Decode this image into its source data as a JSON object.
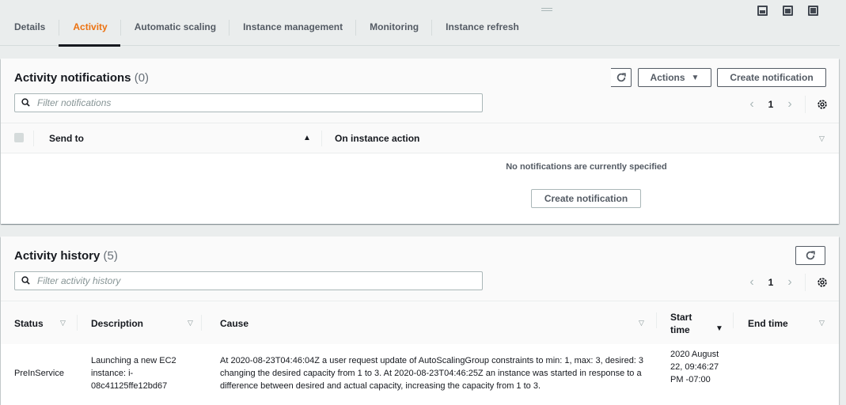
{
  "tabs": [
    {
      "label": "Details",
      "active": false
    },
    {
      "label": "Activity",
      "active": true
    },
    {
      "label": "Automatic scaling",
      "active": false
    },
    {
      "label": "Instance management",
      "active": false
    },
    {
      "label": "Monitoring",
      "active": false
    },
    {
      "label": "Instance refresh",
      "active": false
    }
  ],
  "view_icons": [
    "split-bottom-small-icon",
    "split-bottom-large-icon",
    "full-view-icon"
  ],
  "colors": {
    "accent": "#ec7211",
    "text": "#16191f",
    "muted": "#545b64",
    "background": "#eaeded"
  },
  "notifications": {
    "title": "Activity notifications",
    "count": "(0)",
    "refresh_icon": "refresh-icon",
    "actions_label": "Actions",
    "create_label": "Create notification",
    "filter_placeholder": "Filter notifications",
    "pagination": {
      "page": "1"
    },
    "columns": [
      {
        "label": "Send to",
        "sort": "ascending"
      },
      {
        "label": "On instance action",
        "sort": "none"
      }
    ],
    "empty_message": "No notifications are currently specified",
    "empty_create_label": "Create notification"
  },
  "history": {
    "title": "Activity history",
    "count": "(5)",
    "refresh_icon": "refresh-icon",
    "filter_placeholder": "Filter activity history",
    "pagination": {
      "page": "1"
    },
    "columns": [
      {
        "label": "Status",
        "sort": "none"
      },
      {
        "label": "Description",
        "sort": "none"
      },
      {
        "label": "Cause",
        "sort": "none"
      },
      {
        "label": "Start time",
        "sort": "descending"
      },
      {
        "label": "End time",
        "sort": "none"
      }
    ],
    "rows": [
      {
        "status": "PreInService",
        "description": "Launching a new EC2 instance: i-08c41125ffe12bd67",
        "cause": "At 2020-08-23T04:46:04Z a user request update of AutoScalingGroup constraints to min: 1, max: 3, desired: 3 changing the desired capacity from 1 to 3. At 2020-08-23T04:46:25Z an instance was started in response to a difference between desired and actual capacity, increasing the capacity from 1 to 3.",
        "start_time": "2020 August 22, 09:46:27 PM -07:00",
        "end_time": ""
      }
    ]
  }
}
